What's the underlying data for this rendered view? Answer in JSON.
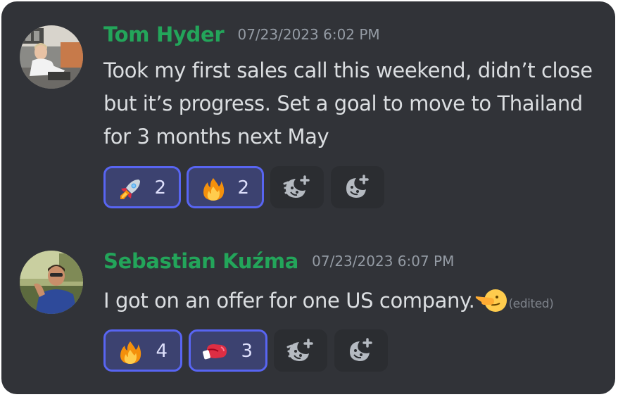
{
  "messages": [
    {
      "author": "Tom Hyder",
      "timestamp": "07/23/2023 6:02 PM",
      "text": "Took my first sales call this weekend, didn’t close but it’s progress. Set a goal to move to Thailand for 3 months next May",
      "reactions": [
        {
          "emoji": "rocket-icon",
          "count": "2"
        },
        {
          "emoji": "fire-icon",
          "count": "2"
        }
      ]
    },
    {
      "author": "Sebastian Kuźma",
      "timestamp": "07/23/2023 6:07 PM",
      "text": "I got on an offer for one US company.",
      "inline_emoji": "pointing-face-icon",
      "edited_label": "(edited)",
      "reactions": [
        {
          "emoji": "fire-icon",
          "count": "4"
        },
        {
          "emoji": "boxing-glove-icon",
          "count": "3"
        }
      ]
    }
  ],
  "colors": {
    "background": "#313338",
    "username": "#23a55a",
    "reaction_active_bg": "#3c4270",
    "reaction_active_border": "#5865f2"
  }
}
